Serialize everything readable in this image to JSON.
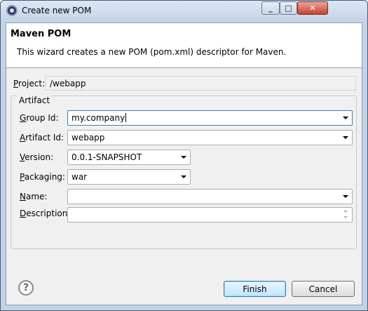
{
  "window": {
    "title": "Create new POM",
    "controls": {
      "minimize": "_",
      "maximize": "□",
      "close": "✕"
    }
  },
  "header": {
    "title": "Maven POM",
    "description": "This wizard creates a new POM (pom.xml) descriptor for Maven."
  },
  "project": {
    "label_underlined": "P",
    "label_rest": "roject:",
    "value": "/webapp"
  },
  "artifact": {
    "legend": "Artifact",
    "group_id": {
      "label_underlined": "G",
      "label_rest": "roup Id:",
      "value": "my.company"
    },
    "artifact_id": {
      "label_underlined": "A",
      "label_rest": "rtifact Id:",
      "value": "webapp"
    },
    "version": {
      "label_underlined": "V",
      "label_rest": "ersion:",
      "value": "0.0.1-SNAPSHOT"
    },
    "packaging": {
      "label_underlined": "P",
      "label_rest": "ackaging:",
      "value": "war"
    },
    "name": {
      "label_underlined": "N",
      "label_rest": "ame:",
      "value": ""
    },
    "description": {
      "label_underlined": "D",
      "label_rest": "escription:",
      "value": ""
    }
  },
  "footer": {
    "help_icon": "?",
    "finish_label": "Finish",
    "cancel_label": "Cancel"
  },
  "icons": [
    "app-icon",
    "help-icon",
    "dropdown-arrow-icon",
    "spinner-icon"
  ]
}
